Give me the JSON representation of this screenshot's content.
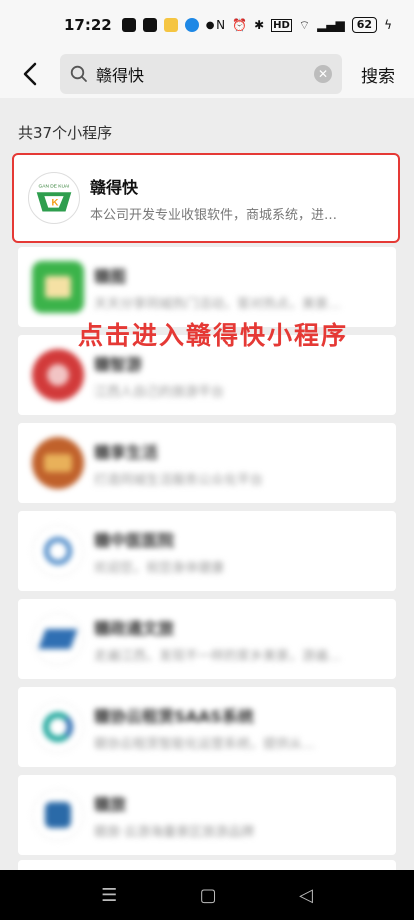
{
  "status_bar": {
    "time": "17:22",
    "battery": "62"
  },
  "search": {
    "value": "赣得快",
    "button_label": "搜索"
  },
  "result_count": "共37个小程序",
  "results": [
    {
      "name": "赣得快",
      "desc": "本公司开发专业收银软件，商城系统，进…",
      "logo_text": "GAN DE KUAI",
      "color": "#2e9e4e"
    },
    {
      "name": "赣图",
      "desc": "天天分享同城热门活动，答对热点，美景…",
      "color": "#3bb34a"
    },
    {
      "name": "赣智游",
      "desc": "江西人自己的旅游平台",
      "color": "#d23a3a"
    },
    {
      "name": "赣享生活",
      "desc": "打造同城生活服务公众化平台",
      "color": "#c0612b"
    },
    {
      "name": "赣中医医院",
      "desc": "欢迎您，祝您身体健康",
      "color": "#4a88c7"
    },
    {
      "name": "赣政通文旅",
      "desc": "走遍江西，发现不一样的家乡美景，游遍…",
      "color": "#2f6fb3"
    },
    {
      "name": "赣协云租赁SAAS系统",
      "desc": "赣协云租赁智能化运营系统，提供从…",
      "color": "#19a59a"
    },
    {
      "name": "赣旅",
      "desc": "赣旅·云游海量景区旅游品牌",
      "color": "#2a6aa8"
    }
  ],
  "annotation": "点击进入赣得快小程序",
  "colors": {
    "highlight": "#e53935",
    "background": "#ededed"
  }
}
